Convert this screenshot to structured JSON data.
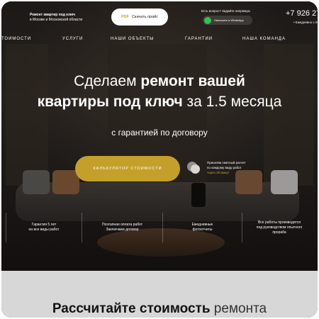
{
  "header": {
    "company_line1": "Ремонт квартир под ключ",
    "company_line2": "в Москве и Московской области",
    "price_button": {
      "pdf": "PDF",
      "label": "Скачать прайс"
    },
    "question": "Есть вопрос? Задайте напрямую",
    "whatsapp_label": "Напишите в WhatsApp",
    "phone": "+7 926 27",
    "schedule": "• Ежедневно с 9"
  },
  "nav": {
    "items": [
      "тоимости",
      "услуги",
      "наши объекты",
      "гарантии",
      "наша команда"
    ]
  },
  "hero": {
    "title_line1_normal": "Сделаем ",
    "title_line1_bold": "ремонт вашей",
    "title_line2_bold": "квартиры под ключ",
    "title_line2_normal": " за 1.5 месяца",
    "subtitle": "с гарантией по договору",
    "cta": "калькулятор стоимости",
    "hint_line1": "Пришлем сметный расчет",
    "hint_line2": "по каждому виду работ",
    "hint_highlight": "через 30 минут"
  },
  "features": [
    {
      "line1": "Гарантия 5 лет",
      "line2": "на все виды работ"
    },
    {
      "line1": "Поэтапная оплата работ",
      "line2": "Заключаем договор"
    },
    {
      "line1": "Ежедневные",
      "line2": "фотоотчеты"
    },
    {
      "line1": "Все работы производятся",
      "line2": "под руководством опытного",
      "line3": "прораба"
    }
  ],
  "calculator": {
    "title_bold": "Рассчитайте стоимость",
    "title_light": " ремонта"
  },
  "colors": {
    "accent": "#c4a02a",
    "whatsapp": "#29c553",
    "bottom_bg": "#d7d7d7"
  }
}
